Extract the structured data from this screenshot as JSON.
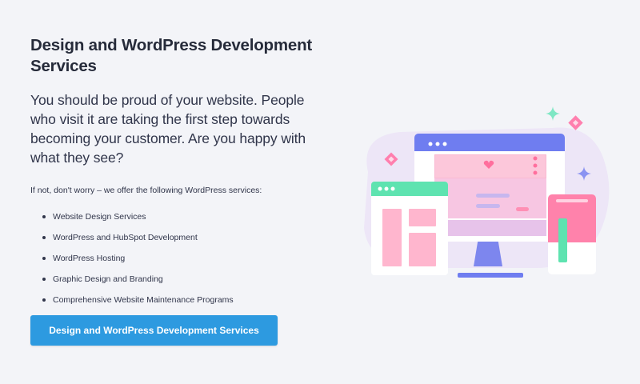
{
  "heading": "Design and WordPress Development Services",
  "lead": "You should be proud of your website. People who visit it are taking the first step towards becoming your customer. Are you happy with what they see?",
  "intro": "If not, don't worry – we offer the following WordPress services:",
  "services": [
    "Website Design Services",
    "WordPress and HubSpot Development",
    "WordPress Hosting",
    "Graphic Design and Branding",
    "Comprehensive Website Maintenance Programs"
  ],
  "cta_label": "Design and WordPress Development Services",
  "colors": {
    "background": "#f3f4f8",
    "button": "#2d9ae0",
    "monitor_bar": "#6f7df0",
    "pink": "#ff8fb4",
    "green": "#5ee3b0"
  }
}
